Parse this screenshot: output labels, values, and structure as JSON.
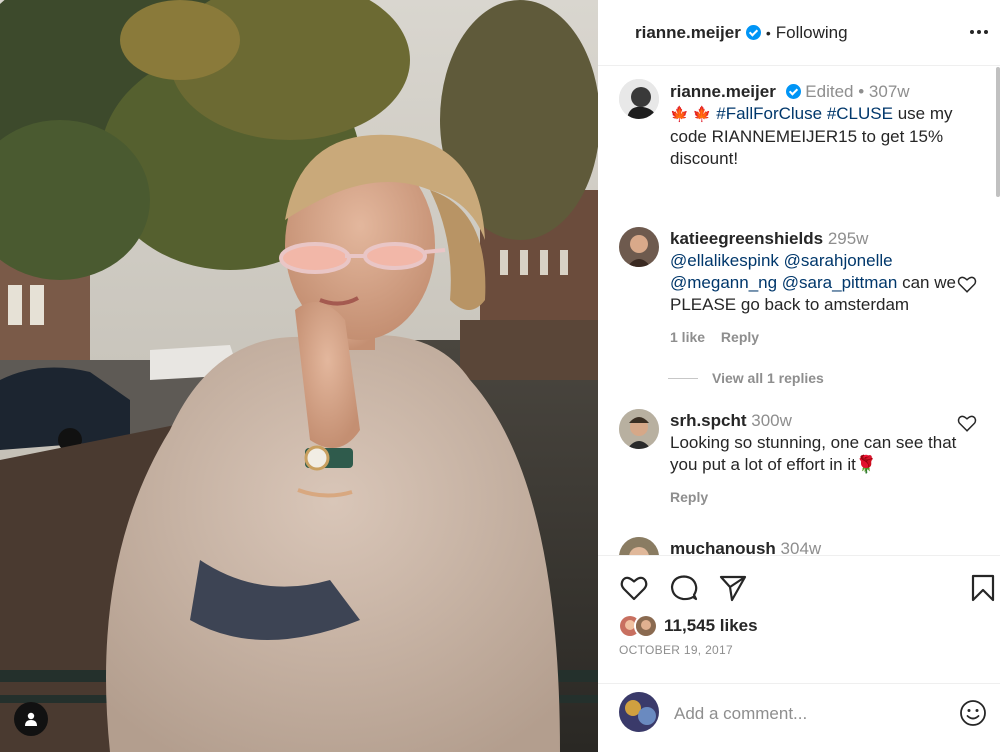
{
  "post": {
    "image_alt": "Woman in pink sunglasses and fluffy coat on an Amsterdam canal bridge",
    "author": "rianne.meijer",
    "follow_state": "Following",
    "separator": "•"
  },
  "caption": {
    "username": "rianne.meijer",
    "edited": "Edited",
    "dot": "•",
    "age": "307w",
    "emoji": "🍁 🍁",
    "hashtag_1": "#FallForCluse",
    "hashtag_2": "#CLUSE",
    "text": "use my code RIANNEMEIJER15 to get 15% discount!"
  },
  "comments": [
    {
      "username": "katieegreenshields",
      "age": "295w",
      "mention_1": "@ellalikespink",
      "mention_2": "@sarahjonelle",
      "mention_3": "@megann_ng",
      "mention_4": "@sara_pittman",
      "text": "can we PLEASE go back to amsterdam",
      "likes": "1 like",
      "reply": "Reply",
      "view_replies": "View all 1 replies"
    },
    {
      "username": "srh.spcht",
      "age": "300w",
      "text": "Looking so stunning, one can see that you put a lot of effort in it🌹",
      "reply": "Reply"
    },
    {
      "username": "muchanoush",
      "age": "304w"
    }
  ],
  "actions": {
    "likes_count": "11,545 likes",
    "date": "OCTOBER 19, 2017"
  },
  "add_comment": {
    "placeholder": "Add a comment..."
  },
  "colors": {
    "verified": "#0095f6",
    "link": "#00376b",
    "muted": "#8e8e8e",
    "text": "#262626"
  },
  "icons": [
    "verified-badge-icon",
    "more-options-icon",
    "heart-icon",
    "comment-icon",
    "share-icon",
    "bookmark-icon",
    "emoji-icon",
    "user-tag-icon"
  ]
}
